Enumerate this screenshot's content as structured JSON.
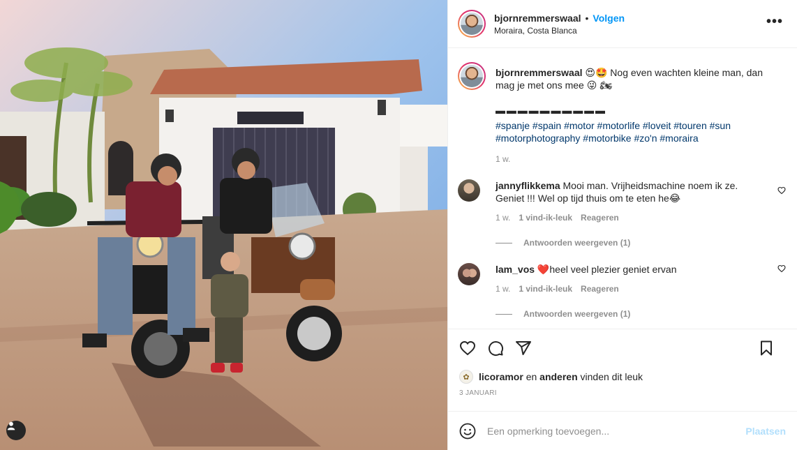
{
  "header": {
    "username": "bjornremmerswaal",
    "separator": "•",
    "follow_label": "Volgen",
    "location": "Moraira, Costa Blanca",
    "more_label": "•••"
  },
  "caption": {
    "username": "bjornremmerswaal",
    "text_start": " 😍🤩 Nog even wachten kleine man, dan mag je met ons mee 😜 🏍",
    "dashes": "▬ ▬ ▬ ▬ ▬ ▬ ▬ ▬ ▬ ▬",
    "hashtags": "#spanje #spain #motor #motorlife #loveit #touren #sun #motorphotography #motorbike #zo'n #moraira",
    "time": "1 w."
  },
  "comments": [
    {
      "username": "jannyflikkema",
      "text": " Mooi man. Vrijheidsmachine noem ik ze. Geniet !!! Wel op tijd thuis om te eten he😂",
      "time": "1 w.",
      "likes": "1 vind-ik-leuk",
      "reply": "Reageren",
      "view_replies": "Antwoorden weergeven (1)"
    },
    {
      "username": "lam_vos",
      "text": " ❤️heel veel plezier geniet ervan",
      "time": "1 w.",
      "likes": "1 vind-ik-leuk",
      "reply": "Reageren",
      "view_replies": "Antwoorden weergeven (1)"
    }
  ],
  "likes": {
    "user": "licoramor",
    "and": " en ",
    "others": "anderen",
    "suffix": " vinden dit leuk"
  },
  "date": "3 JANUARI",
  "add_comment": {
    "placeholder": "Een opmerking toevoegen...",
    "post_label": "Plaatsen"
  },
  "colors": {
    "link_blue": "#0095f6",
    "hashtag_blue": "#00376b",
    "muted": "#8e8e8e",
    "post_disabled": "#b2dffc"
  },
  "icons": [
    "heart-icon",
    "comment-icon",
    "share-icon",
    "bookmark-icon",
    "emoji-icon",
    "user-tag-icon",
    "more-icon"
  ]
}
